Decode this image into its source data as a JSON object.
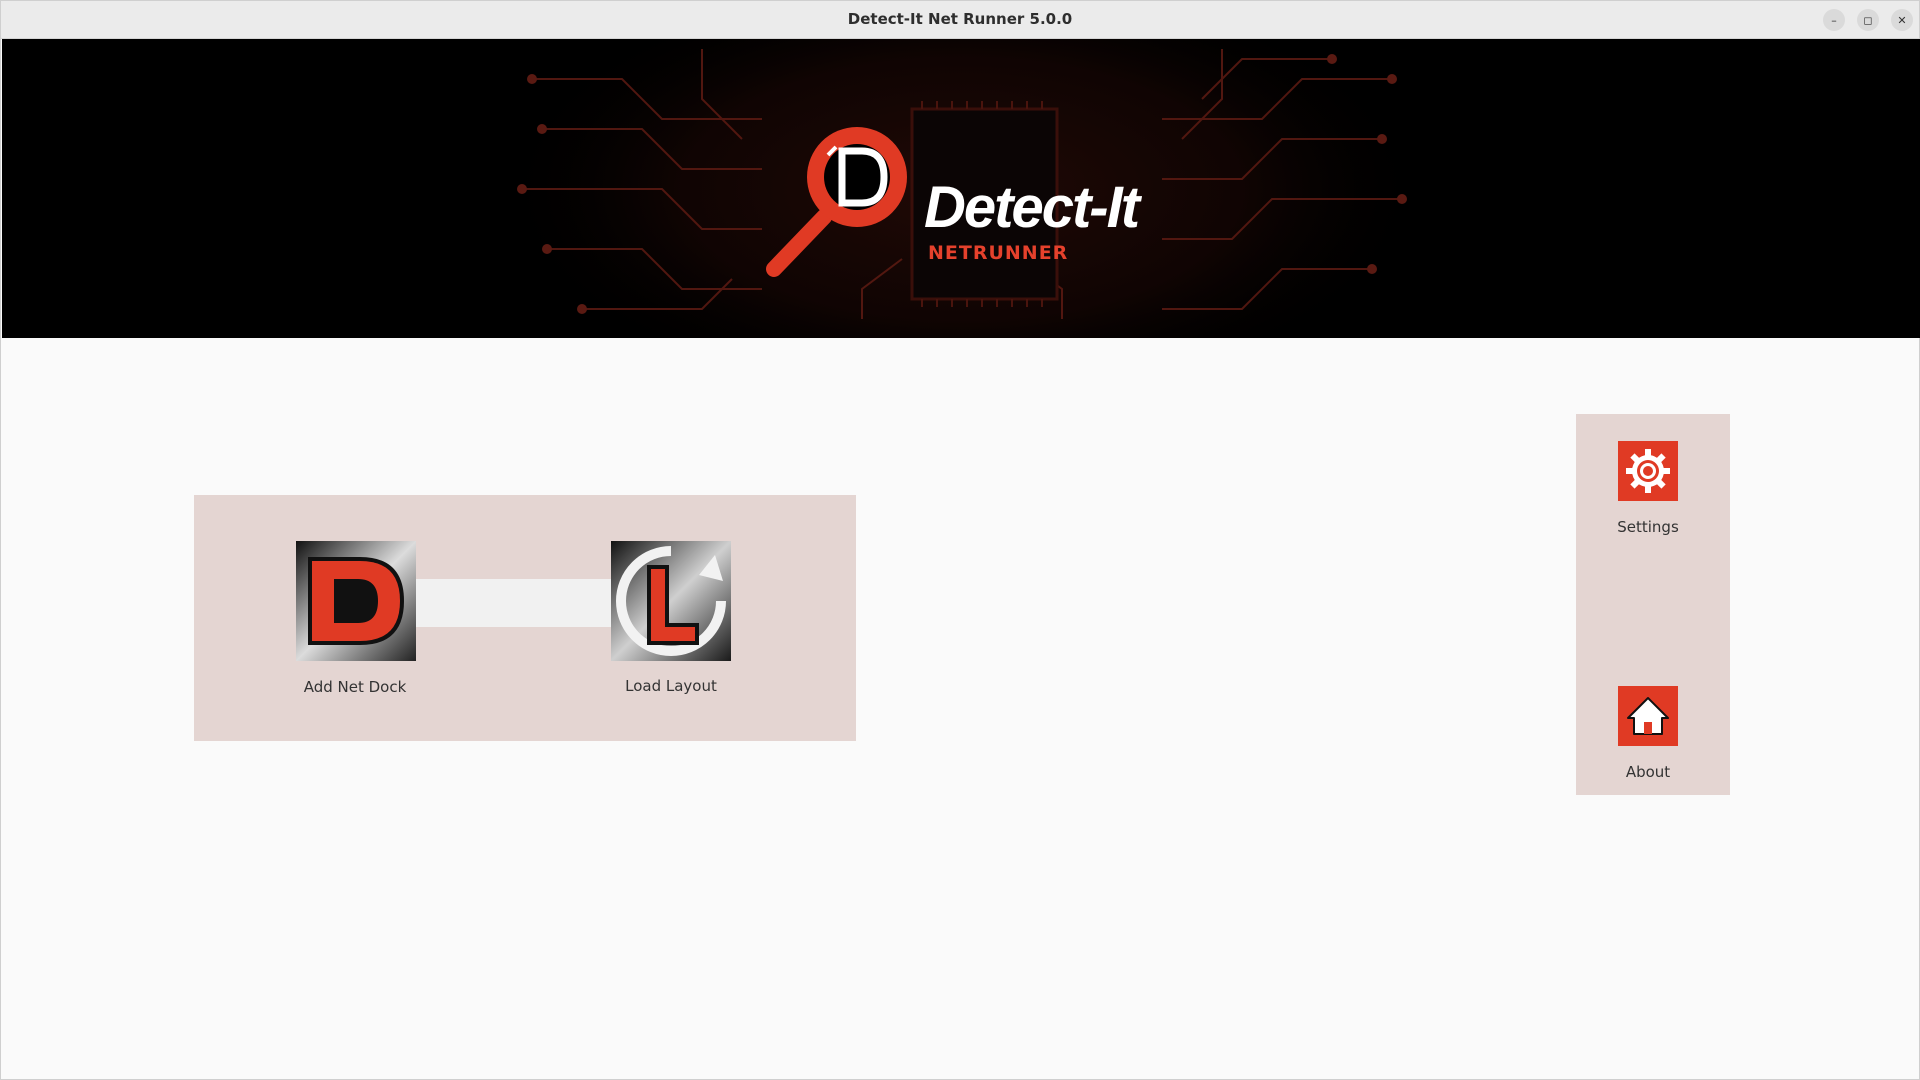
{
  "window": {
    "title": "Detect-It Net Runner 5.0.0",
    "controls": {
      "minimize": "–",
      "maximize": "◻",
      "close": "✕"
    }
  },
  "banner": {
    "logo_word": "Detect-It",
    "logo_sub": "NETRUNNER",
    "accent_color": "#e03a24"
  },
  "actions": {
    "add_net_dock": {
      "label": "Add Net Dock",
      "icon": "d-letter-icon"
    },
    "load_layout": {
      "label": "Load Layout",
      "icon": "l-letter-refresh-icon"
    }
  },
  "side": {
    "settings": {
      "label": "Settings",
      "icon": "gear-icon"
    },
    "about": {
      "label": "About",
      "icon": "home-icon"
    }
  }
}
